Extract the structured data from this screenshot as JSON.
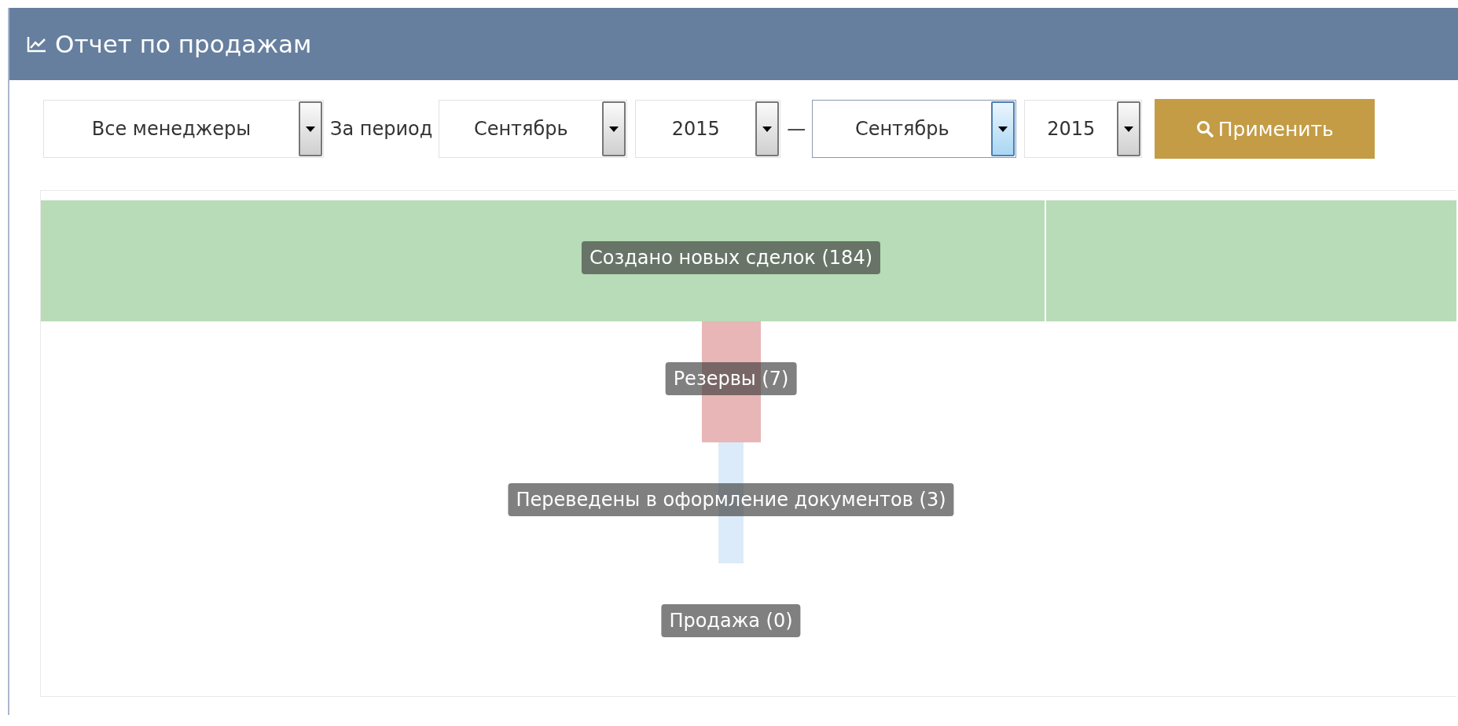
{
  "panel": {
    "title": "Отчет по продажам"
  },
  "filters": {
    "manager": {
      "value": "Все менеджеры",
      "focused": false
    },
    "period_label": "За период",
    "from_month": {
      "value": "Сентябрь",
      "focused": false
    },
    "from_year": {
      "value": "2015",
      "focused": false
    },
    "separator": "—",
    "to_month": {
      "value": "Сентябрь",
      "focused": true
    },
    "to_year": {
      "value": "2015",
      "focused": false
    },
    "apply_button": "Применить"
  },
  "funnel": {
    "stages": [
      {
        "label": "Создано новых сделок (184)",
        "color": "#b7dcb7"
      },
      {
        "label": "Резервы (7)",
        "color": "#e8b6b6"
      },
      {
        "label": "Переведены в оформление документов (3)",
        "color": "#dcebfa"
      },
      {
        "label": "Продажа (0)"
      }
    ]
  }
}
